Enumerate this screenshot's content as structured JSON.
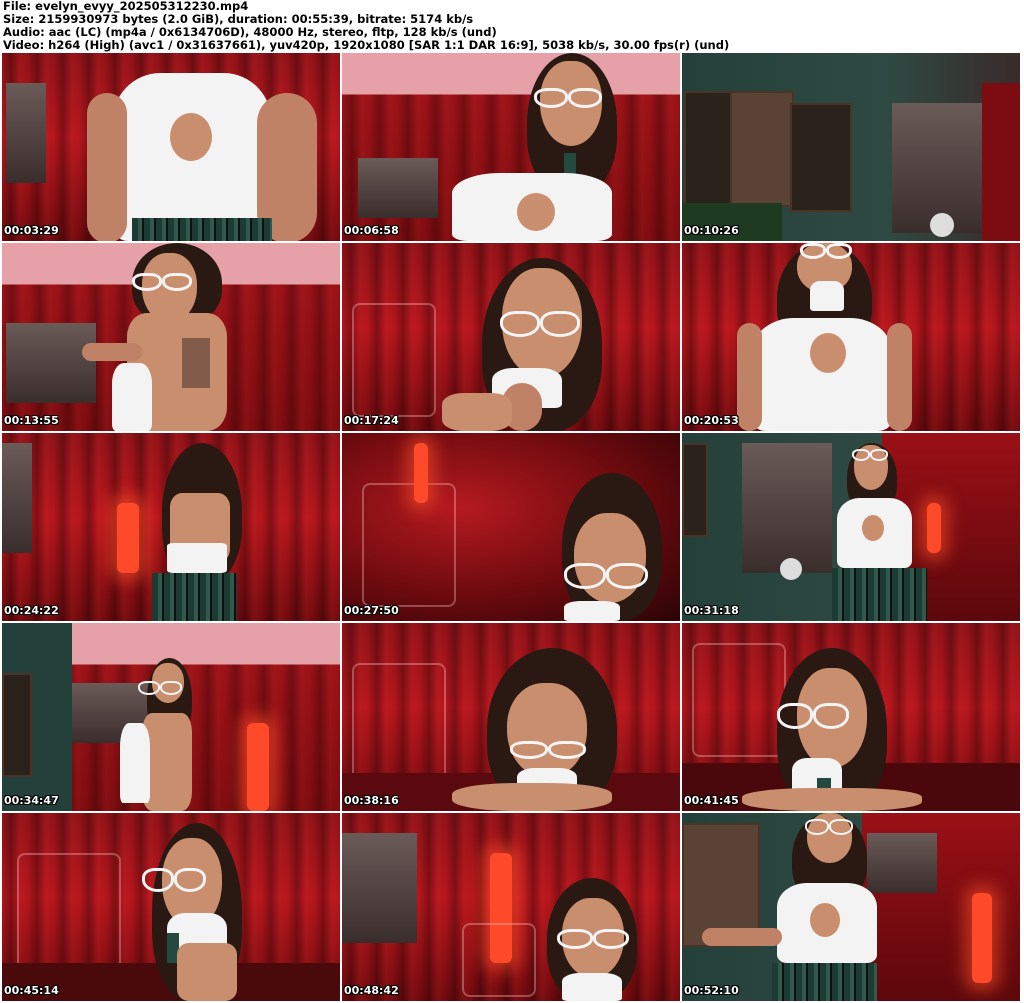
{
  "header": {
    "line1": "File: evelyn_evyy_202505312230.mp4",
    "line2": "Size: 2159930973 bytes (2.0 GiB), duration: 00:55:39, bitrate: 5174 kb/s",
    "line3": "Audio: aac (LC) (mp4a / 0x6134706D), 48000 Hz, stereo, fltp, 128 kb/s (und)",
    "line4": "Video: h264 (High) (avc1 / 0x31637661), yuv420p, 1920x1080 [SAR 1:1 DAR 16:9], 5038 kb/s, 30.00 fps(r) (und)"
  },
  "thumbnails": [
    {
      "timestamp": "00:03:29"
    },
    {
      "timestamp": "00:06:58"
    },
    {
      "timestamp": "00:10:26"
    },
    {
      "timestamp": "00:13:55"
    },
    {
      "timestamp": "00:17:24"
    },
    {
      "timestamp": "00:20:53"
    },
    {
      "timestamp": "00:24:22"
    },
    {
      "timestamp": "00:27:50"
    },
    {
      "timestamp": "00:31:18"
    },
    {
      "timestamp": "00:34:47"
    },
    {
      "timestamp": "00:38:16"
    },
    {
      "timestamp": "00:41:45"
    },
    {
      "timestamp": "00:45:14"
    },
    {
      "timestamp": "00:48:42"
    },
    {
      "timestamp": "00:52:10"
    }
  ]
}
